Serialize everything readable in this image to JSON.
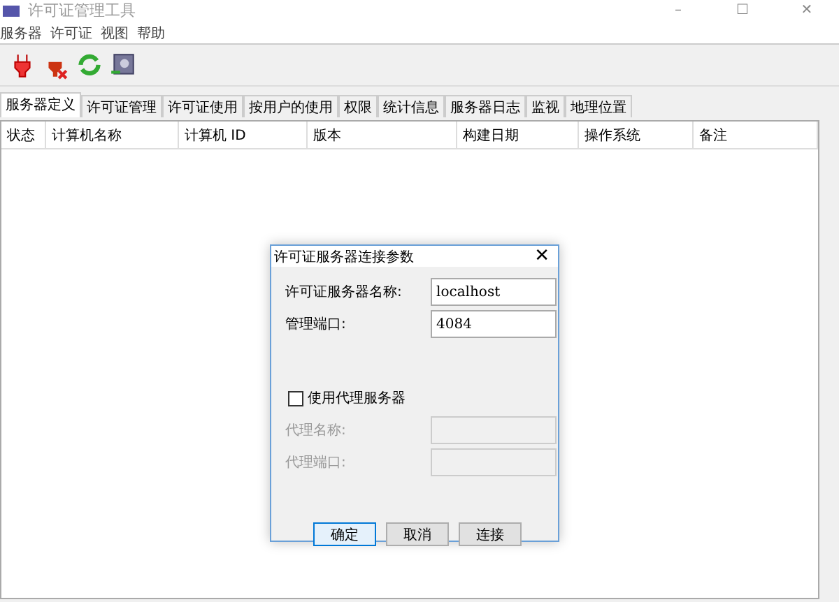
{
  "window": {
    "title": "许可证管理工具",
    "controls": [
      "–",
      "☐",
      "✕"
    ]
  },
  "menu": [
    "服务器",
    "许可证",
    "视图",
    "帮助"
  ],
  "toolbar": [
    {
      "kind": "plug"
    },
    {
      "kind": "unplug"
    },
    {
      "kind": "refresh"
    },
    {
      "kind": "safe"
    }
  ],
  "tabs": [
    {
      "label": "服务器定义",
      "selected": true
    },
    {
      "label": "许可证管理",
      "selected": false
    },
    {
      "label": "许可证使用",
      "selected": false
    },
    {
      "label": "按用户的使用",
      "selected": false
    },
    {
      "label": "权限",
      "selected": false
    },
    {
      "label": "统计信息",
      "selected": false
    },
    {
      "label": "服务器日志",
      "selected": false
    },
    {
      "label": "监视",
      "selected": false
    },
    {
      "label": "地理位置",
      "selected": false
    }
  ],
  "table": {
    "columns": [
      "状态",
      "计算机名称",
      "计算机 ID",
      "版本",
      "构建日期",
      "操作系统",
      "备注"
    ]
  },
  "dialog": {
    "title": "许可证服务器连接参数",
    "close": "✕",
    "fields": [
      {
        "label": "许可证服务器名称:",
        "value": "localhost",
        "disabled": false
      },
      {
        "label": "管理端口:",
        "value": "4084",
        "disabled": false
      }
    ],
    "proxy": {
      "label": "使用代理服务器",
      "checked": false
    },
    "proxy_fields": [
      {
        "label": "代理名称:",
        "disabled": true
      },
      {
        "label": "代理端口:",
        "disabled": true
      }
    ],
    "buttons": [
      {
        "label": "确定",
        "selected": true
      },
      {
        "label": "取消",
        "selected": false
      },
      {
        "label": "连接",
        "selected": false
      }
    ]
  }
}
